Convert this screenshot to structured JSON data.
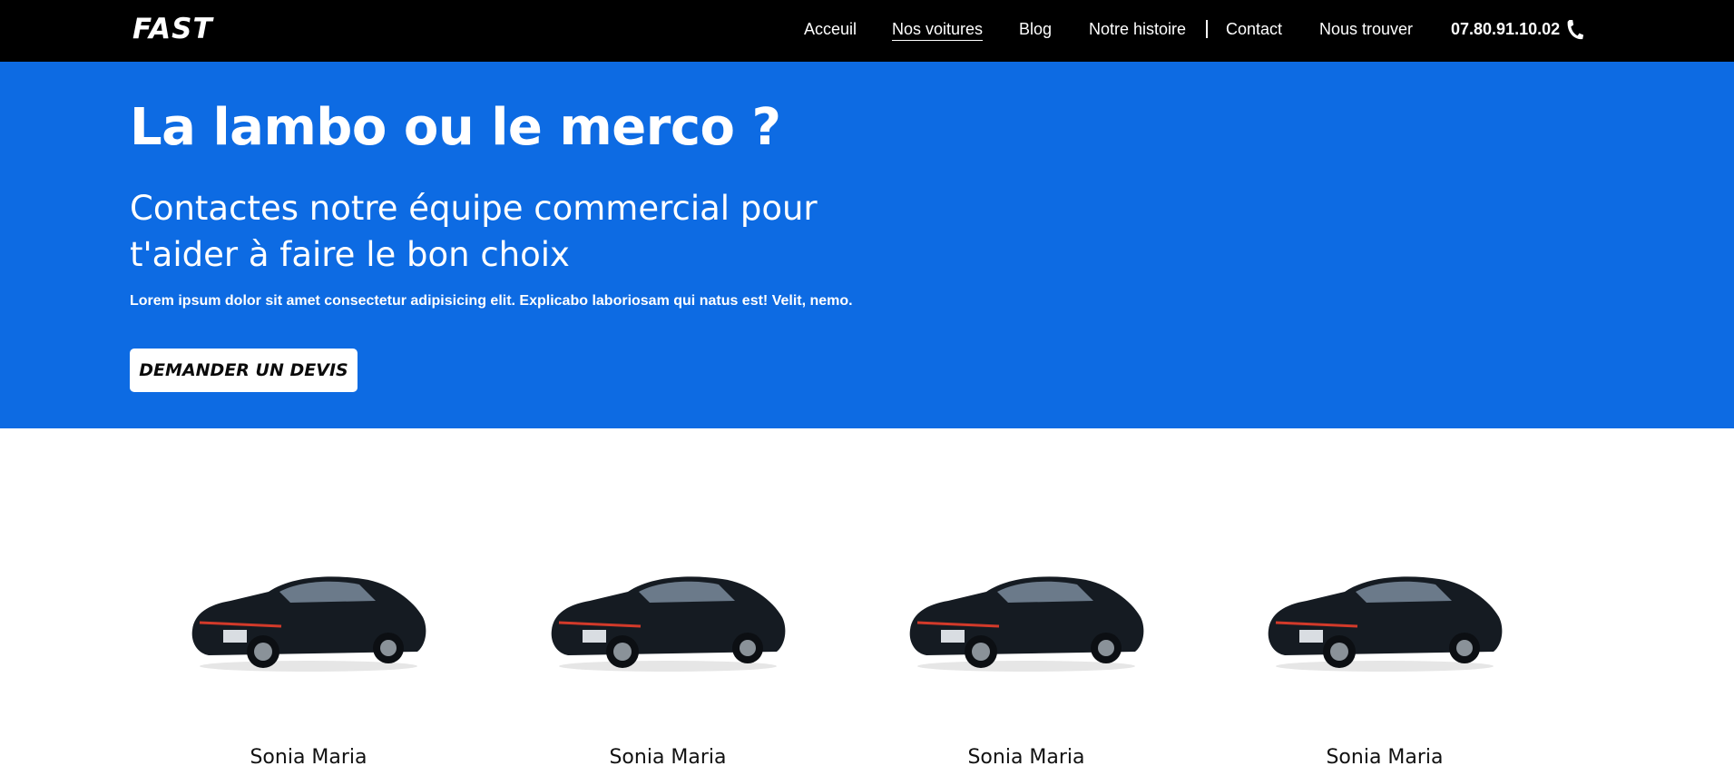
{
  "header": {
    "logo": "FAST",
    "nav": [
      {
        "label": "Acceuil",
        "active": false
      },
      {
        "label": "Nos voitures",
        "active": true
      },
      {
        "label": "Blog",
        "active": false
      },
      {
        "label": "Notre histoire",
        "active": false
      },
      {
        "label": "Contact",
        "active": false
      },
      {
        "label": "Nous trouver",
        "active": false
      }
    ],
    "phone": "07.80.91.10.02",
    "phone_icon": "phone-icon"
  },
  "hero": {
    "title": "La lambo ou le merco ?",
    "subtitle": "Contactes notre équipe commercial pour t'aider à faire le bon choix",
    "text": "Lorem ipsum dolor sit amet consectetur adipisicing elit. Explicabo laboriosam qui natus est! Velit, nemo.",
    "cta_label": "DEMANDER UN DEVIS"
  },
  "cars": [
    {
      "name": "Sonia Maria"
    },
    {
      "name": "Sonia Maria"
    },
    {
      "name": "Sonia Maria"
    },
    {
      "name": "Sonia Maria"
    }
  ],
  "colors": {
    "topbar": "#000000",
    "hero_bg": "#0d6be3",
    "text_light": "#ffffff"
  }
}
